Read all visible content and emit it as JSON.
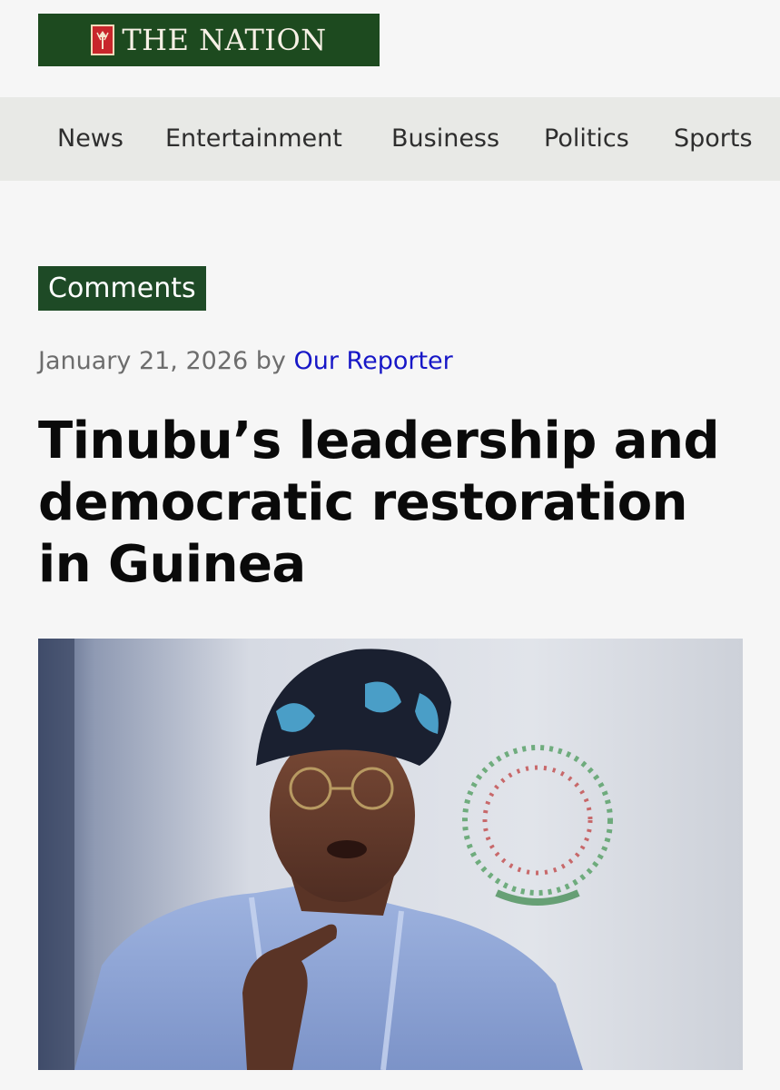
{
  "site": {
    "logo_text": "THE NATION"
  },
  "nav": {
    "items": [
      {
        "label": "News"
      },
      {
        "label": "Entertainment"
      },
      {
        "label": "Business"
      },
      {
        "label": "Politics"
      },
      {
        "label": "Sports"
      }
    ]
  },
  "article": {
    "category": "Comments",
    "date": "January 21, 2026",
    "by": "by",
    "author": "Our Reporter",
    "title": "Tinubu’s leadership and democratic restoration in Guinea"
  },
  "colors": {
    "brand_green": "#1d4a1f",
    "nav_background": "#e8e9e6",
    "author_link": "#1717c7"
  },
  "icons": {
    "logo_emblem": "shield-emblem-icon"
  }
}
